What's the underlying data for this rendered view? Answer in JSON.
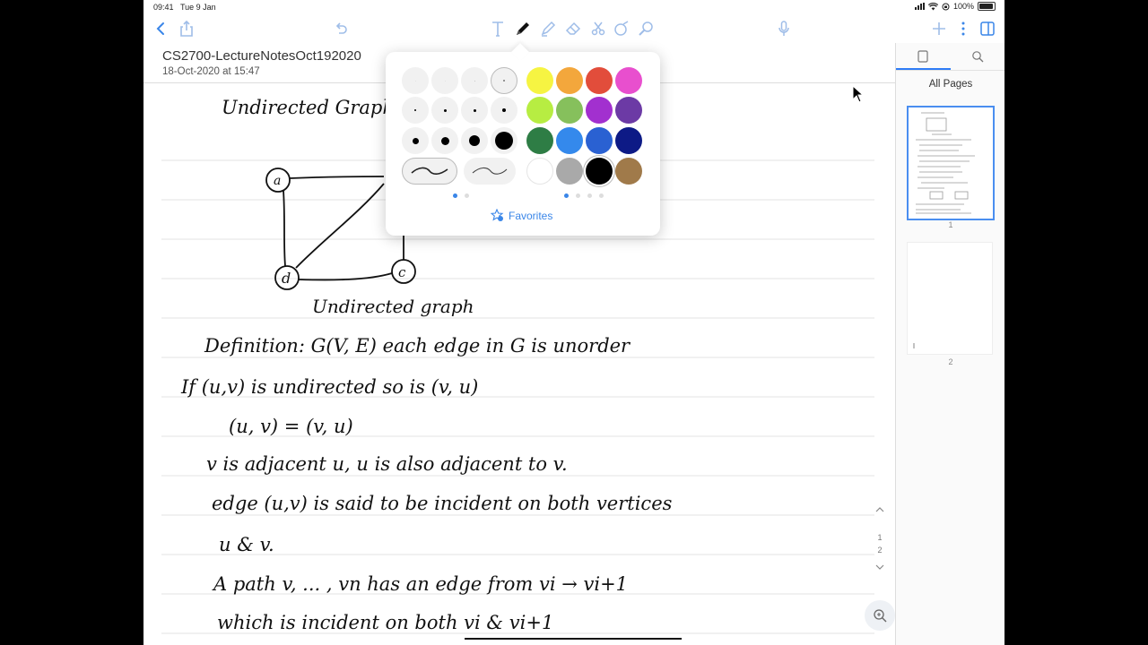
{
  "status": {
    "time": "09:41",
    "date": "Tue 9 Jan",
    "battery": "100%"
  },
  "document": {
    "title": "CS2700-LectureNotesOct192020",
    "date": "18-Oct-2020 at 15:47"
  },
  "toolbar": {
    "left": [
      "back-icon",
      "share-icon",
      "undo-icon"
    ],
    "tools": [
      "text-tool-icon",
      "pen-tool-icon",
      "highlighter-tool-icon",
      "eraser-tool-icon",
      "lasso-tool-icon",
      "shapes-tool-icon",
      "zoom-tool-icon"
    ],
    "right": [
      "mic-icon",
      "add-icon",
      "more-icon",
      "sidebar-icon"
    ]
  },
  "pen_popup": {
    "pen_sizes": [
      "0.5",
      "1",
      "1.5",
      "2",
      "3"
    ],
    "colors": [
      "#f6f442",
      "#f3a73c",
      "#e24d3b",
      "#e84fce",
      "#b7ed42",
      "#86c05c",
      "#a230cf",
      "#6c3aa5",
      "#2e7d45",
      "#3489ec",
      "#2a61d2",
      "#0d1a86",
      "#ffffff",
      "#a9a9a9",
      "#000000",
      "#a07a4a"
    ],
    "favorites_label": "Favorites"
  },
  "sidebar": {
    "tabs": [
      "pages-icon",
      "search-icon"
    ],
    "title": "All Pages",
    "pages": [
      "1",
      "2"
    ]
  },
  "note": {
    "lines": [
      "Undirected Graph",
      "Undirected graph",
      "Definition: G(V, E) each edge in G is unorder",
      "If (u,v) is undirected so is (v, u)",
      "(u, v) = (v, u)",
      "v is adjacent u, u is also adjacent to v.",
      "edge (u,v) is said to be incident on both vertices",
      "u & v.",
      "A path v, ... , vn has an edge from vi → vi+1",
      "which is incident on both vi & vi+1"
    ],
    "graph_nodes": [
      "a",
      "d",
      "c"
    ]
  },
  "scroller": {
    "labels": [
      "1",
      "2"
    ]
  }
}
